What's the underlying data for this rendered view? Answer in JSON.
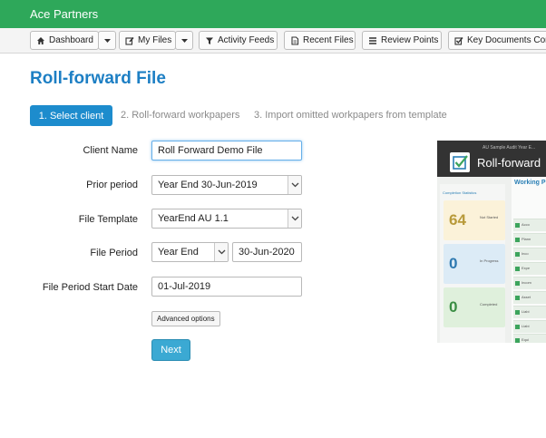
{
  "app": {
    "brand": "Ace Partners"
  },
  "toolbar": {
    "dashboard": "Dashboard",
    "my_files": "My Files",
    "activity_feeds": "Activity Feeds",
    "recent_files": "Recent Files",
    "review_points": "Review Points",
    "key_documents": "Key Documents Comp"
  },
  "page": {
    "title": "Roll-forward File"
  },
  "steps": {
    "step1": "1. Select client",
    "step2": "2. Roll-forward workpapers",
    "step3": "3. Import omitted workpapers from template"
  },
  "form": {
    "client_name_label": "Client Name",
    "client_name_value": "Roll Forward Demo File",
    "prior_period_label": "Prior period",
    "prior_period_value": "Year End 30-Jun-2019",
    "file_template_label": "File Template",
    "file_template_value": "YearEnd AU 1.1",
    "file_period_label": "File Period",
    "file_period_type": "Year End",
    "file_period_date": "30-Jun-2020",
    "start_date_label": "File Period Start Date",
    "start_date_value": "01-Jul-2019",
    "advanced_label": "Advanced options",
    "next_label": "Next"
  },
  "video": {
    "title": "Roll-forward",
    "subtitle": "AU Sample Audit Year E...",
    "panel_heading": "Completion Statistics",
    "panel_right": "Working P",
    "stat1_value": "64",
    "stat1_label": "Not Started",
    "stat2_value": "0",
    "stat2_label": "In Progress",
    "stat3_value": "0",
    "stat3_label": "Completed",
    "rows": [
      "Acco",
      "Plann",
      "Inco",
      "Expe",
      "Incom",
      "Asset",
      "Liabi",
      "Liabi",
      "Equi"
    ]
  },
  "colors": {
    "topbar": "#2ea85a",
    "title": "#1d7fc4",
    "step_active": "#1d8ccd",
    "next_button": "#3ba9d3"
  },
  "icons": {
    "dashboard": "home-icon",
    "my_files": "edit-icon",
    "activity_feeds": "filter-icon",
    "recent_files": "document-icon",
    "review_points": "list-icon",
    "key_documents": "check-square-icon"
  }
}
